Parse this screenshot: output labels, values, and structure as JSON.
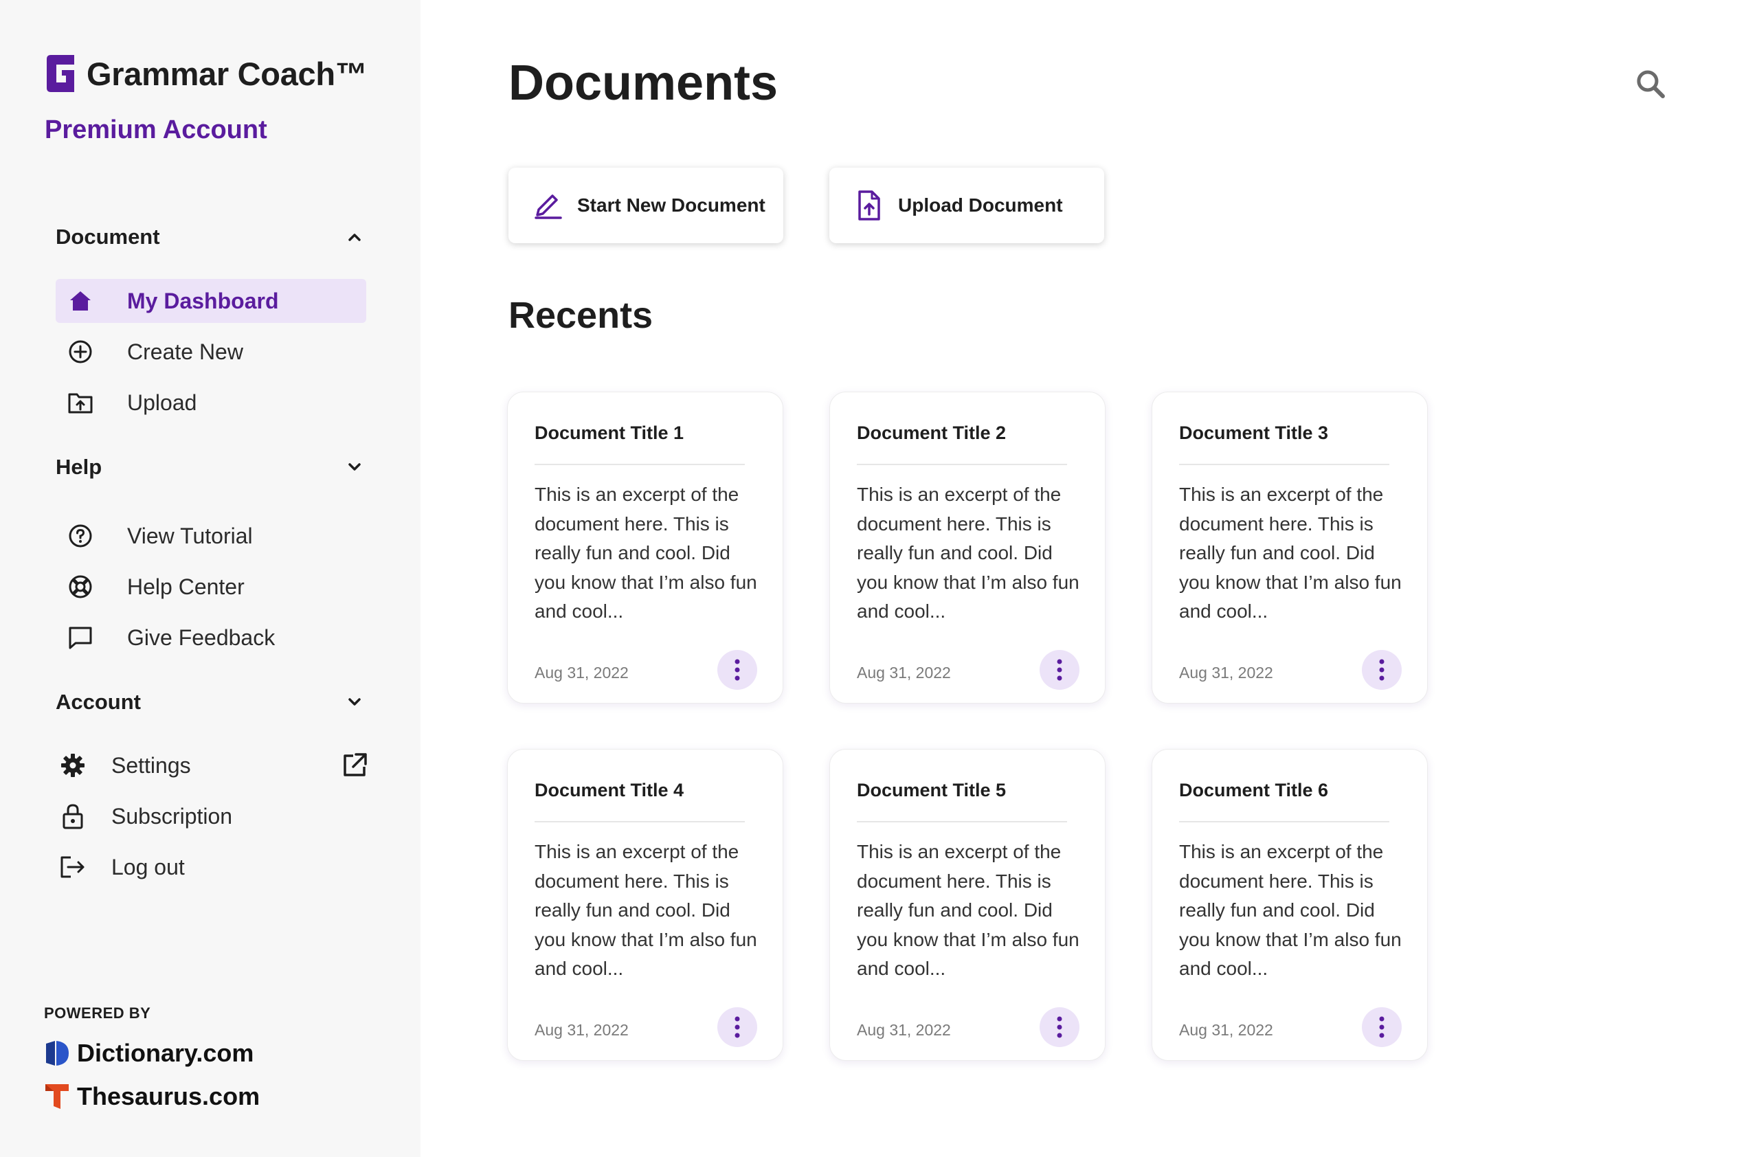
{
  "brand": {
    "name": "Grammar Coach™",
    "account_type": "Premium Account",
    "accent_color": "#5a1c9e",
    "accent_light": "#ece3f8"
  },
  "sidebar": {
    "document_section": {
      "label": "Document",
      "expanded": true,
      "items": [
        {
          "label": "My Dashboard",
          "icon": "home-icon",
          "active": true
        },
        {
          "label": "Create New",
          "icon": "plus-circle-icon",
          "active": false
        },
        {
          "label": "Upload",
          "icon": "folder-upload-icon",
          "active": false
        }
      ]
    },
    "help_section": {
      "label": "Help",
      "expanded": false,
      "items": [
        {
          "label": "View Tutorial",
          "icon": "question-circle-icon"
        },
        {
          "label": "Help Center",
          "icon": "lifebuoy-icon"
        },
        {
          "label": "Give Feedback",
          "icon": "chat-bubble-icon"
        }
      ]
    },
    "account_section": {
      "label": "Account",
      "expanded": false,
      "items": [
        {
          "label": "Settings",
          "icon": "gear-icon",
          "external": true
        },
        {
          "label": "Subscription",
          "icon": "lock-icon"
        },
        {
          "label": "Log out",
          "icon": "logout-icon"
        }
      ]
    },
    "powered_by": {
      "label": "POWERED BY",
      "partners": [
        "Dictionary.com",
        "Thesaurus.com"
      ]
    }
  },
  "main": {
    "title": "Documents",
    "actions": [
      {
        "label": "Start New Document",
        "icon": "pen-icon"
      },
      {
        "label": "Upload Document",
        "icon": "file-upload-icon"
      }
    ],
    "recents_title": "Recents",
    "documents": [
      {
        "title": "Document Title 1",
        "excerpt": "This is an excerpt of the document here. This is really fun and cool. Did you know that I’m also fun and cool...",
        "date": "Aug 31, 2022"
      },
      {
        "title": "Document Title 2",
        "excerpt": "This is an excerpt of the document here. This is really fun and cool. Did you know that I’m also fun and cool...",
        "date": "Aug 31, 2022"
      },
      {
        "title": "Document Title 3",
        "excerpt": "This is an excerpt of the document here. This is really fun and cool. Did you know that I’m also fun and cool...",
        "date": "Aug 31, 2022"
      },
      {
        "title": "Document Title 4",
        "excerpt": "This is an excerpt of the document here. This is really fun and cool. Did you know that I’m also fun and cool...",
        "date": "Aug 31, 2022"
      },
      {
        "title": "Document Title 5",
        "excerpt": "This is an excerpt of the document here. This is really fun and cool. Did you know that I’m also fun and cool...",
        "date": "Aug 31, 2022"
      },
      {
        "title": "Document Title 6",
        "excerpt": "This is an excerpt of the document here. This is really fun and cool. Did you know that I’m also fun and cool...",
        "date": "Aug 31, 2022"
      }
    ]
  }
}
